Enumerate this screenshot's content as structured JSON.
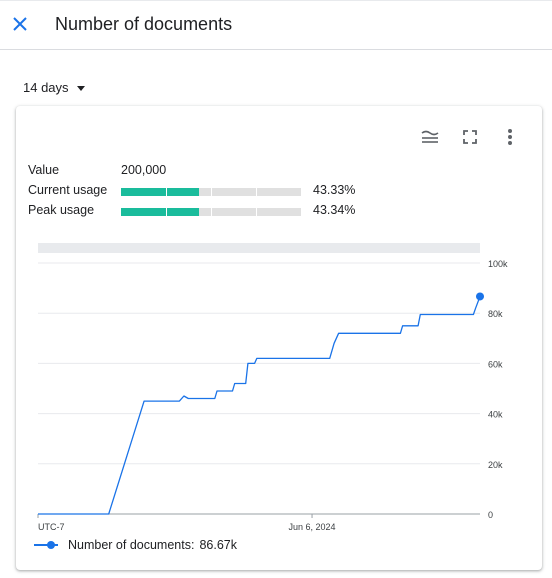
{
  "header": {
    "title": "Number of documents",
    "close_icon": "close-icon"
  },
  "range": {
    "label": "14 days"
  },
  "card": {
    "toolbar": {
      "legend_icon": "legend-toggle-icon",
      "fullscreen_icon": "fullscreen-icon",
      "more_icon": "more-vert-icon"
    },
    "stats": {
      "value_label": "Value",
      "value": "200,000",
      "current_label": "Current usage",
      "current_pct_text": "43.33%",
      "current_fraction": 0.4333,
      "peak_label": "Peak usage",
      "peak_pct_text": "43.34%",
      "peak_fraction": 0.4334
    },
    "legend": {
      "label": "Number of documents:",
      "value": "86.67k"
    }
  },
  "colors": {
    "accent": "#1a73e8",
    "usage_bar": "#1abc9c",
    "bar_track": "#e0e0e0"
  },
  "chart_data": {
    "type": "line",
    "x_tick_labels": [
      "UTC-7",
      "Jun 6, 2024"
    ],
    "y_tick_labels": [
      "100k",
      "80k",
      "60k",
      "40k",
      "20k",
      "0"
    ],
    "ylim": [
      0,
      100000
    ],
    "grid": true,
    "legend_placement": "bottom-left",
    "series": [
      {
        "name": "Number of documents",
        "x": [
          0,
          0.16,
          0.24,
          0.32,
          0.33,
          0.34,
          0.4,
          0.405,
          0.44,
          0.445,
          0.47,
          0.475,
          0.49,
          0.495,
          0.53,
          0.66,
          0.67,
          0.68,
          0.82,
          0.825,
          0.86,
          0.865,
          0.985,
          0.99,
          1.0
        ],
        "y": [
          0,
          0,
          45000,
          45000,
          47000,
          46000,
          46000,
          49000,
          49000,
          52000,
          52000,
          60000,
          60000,
          62000,
          62000,
          62000,
          68000,
          72000,
          72000,
          75000,
          75000,
          79500,
          79500,
          82000,
          86670
        ]
      }
    ]
  }
}
